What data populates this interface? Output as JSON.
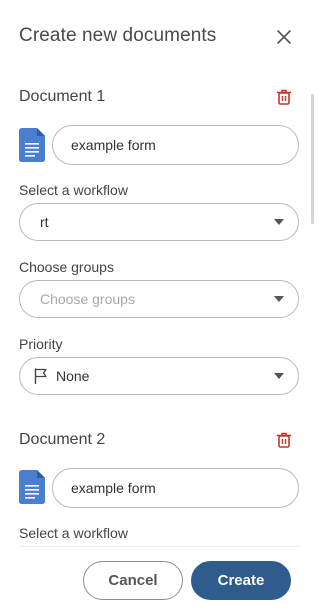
{
  "dialog": {
    "title": "Create new documents"
  },
  "documents": [
    {
      "title": "Document 1",
      "name_value": "example form",
      "workflow_label": "Select a workflow",
      "workflow_value": "rt",
      "groups_label": "Choose groups",
      "groups_placeholder": "Choose groups",
      "priority_label": "Priority",
      "priority_value": "None"
    },
    {
      "title": "Document 2",
      "name_value": "example form",
      "workflow_label": "Select a workflow"
    }
  ],
  "footer": {
    "cancel_label": "Cancel",
    "create_label": "Create"
  },
  "colors": {
    "accent": "#2f5c8c",
    "delete": "#c0392b",
    "doc_icon": "#4a7fcf"
  },
  "icons": {
    "close": "close-icon",
    "delete": "trash-icon",
    "document": "document-icon",
    "priority": "flag-icon",
    "dropdown": "chevron-down-icon"
  }
}
